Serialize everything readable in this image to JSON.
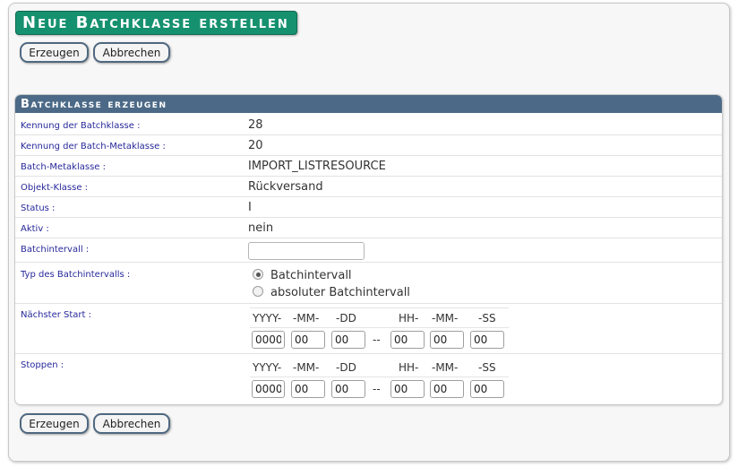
{
  "page": {
    "title": "Neue Batchklasse erstellen",
    "buttons": {
      "create": "Erzeugen",
      "cancel": "Abbrechen"
    }
  },
  "panel": {
    "header": "Batchklasse erzeugen",
    "fields": {
      "kennung": {
        "label": "Kennung der Batchklasse :",
        "value": "28"
      },
      "meta_kennung": {
        "label": "Kennung der Batch-Metaklasse :",
        "value": "20"
      },
      "metaklasse": {
        "label": "Batch-Metaklasse :",
        "value": "IMPORT_LISTRESOURCE"
      },
      "objekt": {
        "label": "Objekt-Klasse :",
        "value": "Rückversand"
      },
      "status": {
        "label": "Status :",
        "value": "I"
      },
      "aktiv": {
        "label": "Aktiv :",
        "value": "nein"
      },
      "intervall": {
        "label": "Batchintervall :",
        "value": ""
      },
      "typ": {
        "label": "Typ des Batchintervalls :",
        "options": [
          "Batchintervall",
          "absoluter Batchintervall"
        ],
        "selected": "Batchintervall"
      },
      "start": {
        "label": "Nächster Start :"
      },
      "stop": {
        "label": "Stoppen :"
      }
    },
    "datetime": {
      "headers": [
        "YYYY-",
        "-MM-",
        "-DD",
        "HH-",
        "-MM-",
        "-SS"
      ],
      "separator": "--",
      "start_values": [
        "0000",
        "00",
        "00",
        "00",
        "00",
        "00"
      ],
      "stop_values": [
        "0000",
        "00",
        "00",
        "00",
        "00",
        "00"
      ]
    }
  },
  "colors": {
    "title_bg": "#16916f",
    "header_bg": "#4c6a87",
    "label_color": "#27289b"
  }
}
